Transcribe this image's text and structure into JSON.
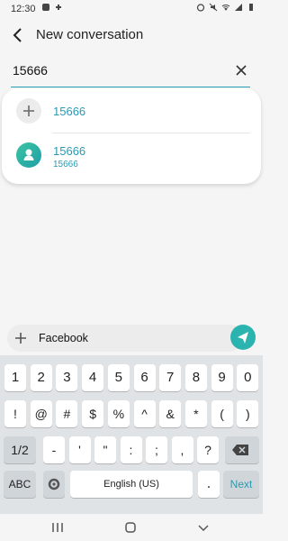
{
  "status": {
    "time": "12:30"
  },
  "header": {
    "title": "New conversation"
  },
  "search": {
    "value": "15666"
  },
  "suggestions": {
    "add_number": "15666",
    "contact_name": "15666",
    "contact_number": "15666"
  },
  "message_bar": {
    "text": "Facebook"
  },
  "keyboard": {
    "row1": [
      "1",
      "2",
      "3",
      "4",
      "5",
      "6",
      "7",
      "8",
      "9",
      "0"
    ],
    "row2": [
      "!",
      "@",
      "#",
      "$",
      "%",
      "^",
      "&",
      "*",
      "(",
      ")"
    ],
    "row3": [
      "-",
      "'",
      "\"",
      ":",
      ";",
      ",",
      "?"
    ],
    "onehalf_label": "1/2",
    "abc_label": "ABC",
    "space_label": "English (US)",
    "dot_label": ".",
    "next_label": "Next"
  },
  "colors": {
    "accent": "#2a9bb3",
    "send": "#2bb3b0",
    "keyboard_bg": "#dfe3e6"
  },
  "icons": {
    "back": "arrow-left-icon",
    "clear": "close-icon",
    "add": "plus-icon",
    "contact": "person-icon",
    "attach": "plus-icon",
    "send": "send-icon",
    "settings": "gear-icon",
    "delete": "backspace-icon",
    "recents": "recents-icon",
    "home": "home-icon",
    "back_nav": "chevron-down-icon"
  }
}
